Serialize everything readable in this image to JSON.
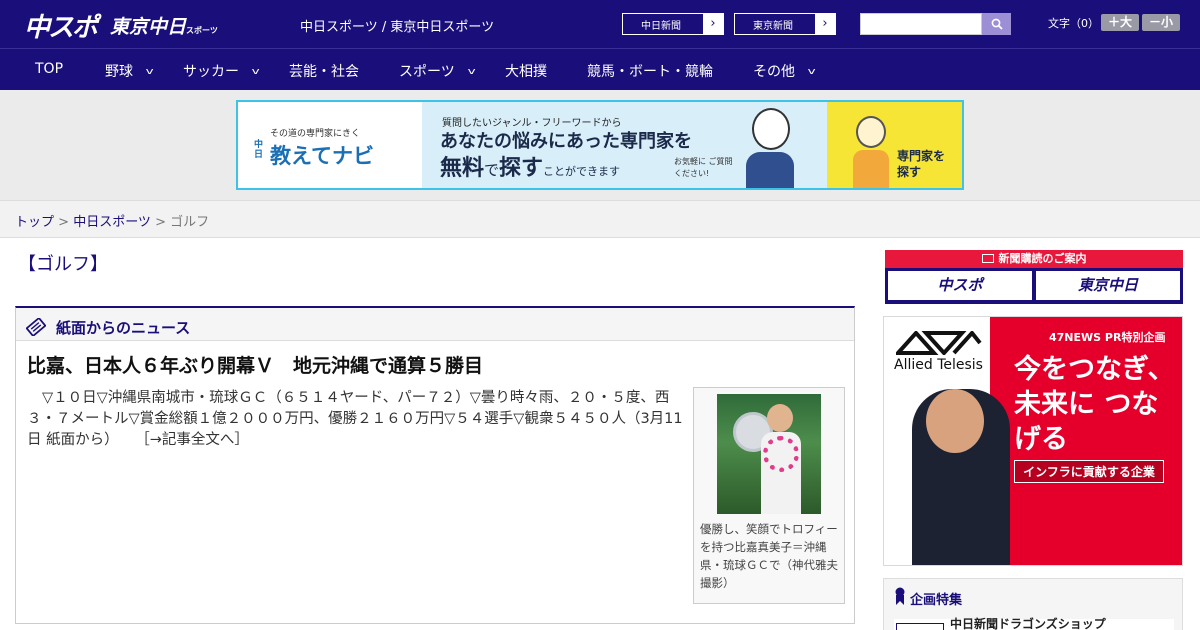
{
  "header": {
    "logo_main": "中スポ",
    "logo_tokyo": "東京中日",
    "logo_tokyo_small": "スポーツ",
    "site_title": "中日スポーツ / 東京中日スポーツ",
    "paper_links": [
      {
        "label": "中日新聞"
      },
      {
        "label": "東京新聞"
      }
    ],
    "search_placeholder": "",
    "font_size_label": "文字（0）",
    "font_plus": "＋大",
    "font_minus": "－小"
  },
  "nav": {
    "items": [
      {
        "label": "TOP"
      },
      {
        "label": "野球"
      },
      {
        "label": "サッカー"
      },
      {
        "label": "芸能・社会"
      },
      {
        "label": "スポーツ"
      },
      {
        "label": "大相撲"
      },
      {
        "label": "競馬・ボート・競輪"
      },
      {
        "label": "その他"
      }
    ]
  },
  "ad_banner": {
    "tagline": "その道の専門家にきく",
    "brand": "教えてナビ",
    "brand_prefix": "中日",
    "line1": "質問したいジャンル・フリーワードから",
    "line2": "あなたの悩みにあった専門家を",
    "line3_a": "無料",
    "line3_b": "で",
    "line3_c": "探す",
    "line3_d": "ことができます",
    "bubble": "お気軽に ご質問ください!",
    "cta": "専門家を 探す"
  },
  "breadcrumb": {
    "top": "トップ",
    "section": "中日スポーツ",
    "current": "ゴルフ"
  },
  "category_title": "【ゴルフ】",
  "news": {
    "box_title": "紙面からのニュース",
    "headline": "比嘉、日本人６年ぶり開幕Ｖ　地元沖縄で通算５勝目",
    "body": "▽１０日▽沖縄県南城市・琉球ＧＣ（６５１４ヤード、パー７２）▽曇り時々雨、２０・５度、西３・７メートル▽賞金総額１億２０００万円、優勝２１６０万円▽５４選手▽観衆５４５０人（3月11日 紙面から）",
    "more_link": "［→記事全文へ］",
    "photo_caption": "優勝し、笑顔でトロフィーを持つ比嘉真美子＝沖縄県・琉球ＧＣで（神代雅夫撮影）"
  },
  "sidebar": {
    "subscribe_bar": "新聞購読のご案内",
    "subscribe_pills": [
      {
        "label": "中スポ"
      },
      {
        "label": "東京中日"
      }
    ],
    "ad": {
      "tag": "47NEWS PR特別企画",
      "company": "Allied Telesis",
      "copy": "今をつなぎ、未来に つなげる",
      "bar": "インフラに貢献する企業"
    },
    "feature_title": "企画特集",
    "feature_item": "中日新聞ドラゴンズショップ"
  },
  "colors": {
    "brand": "#1a0f7a",
    "accent_red": "#e8173c",
    "banner_border": "#3cc3e8"
  }
}
